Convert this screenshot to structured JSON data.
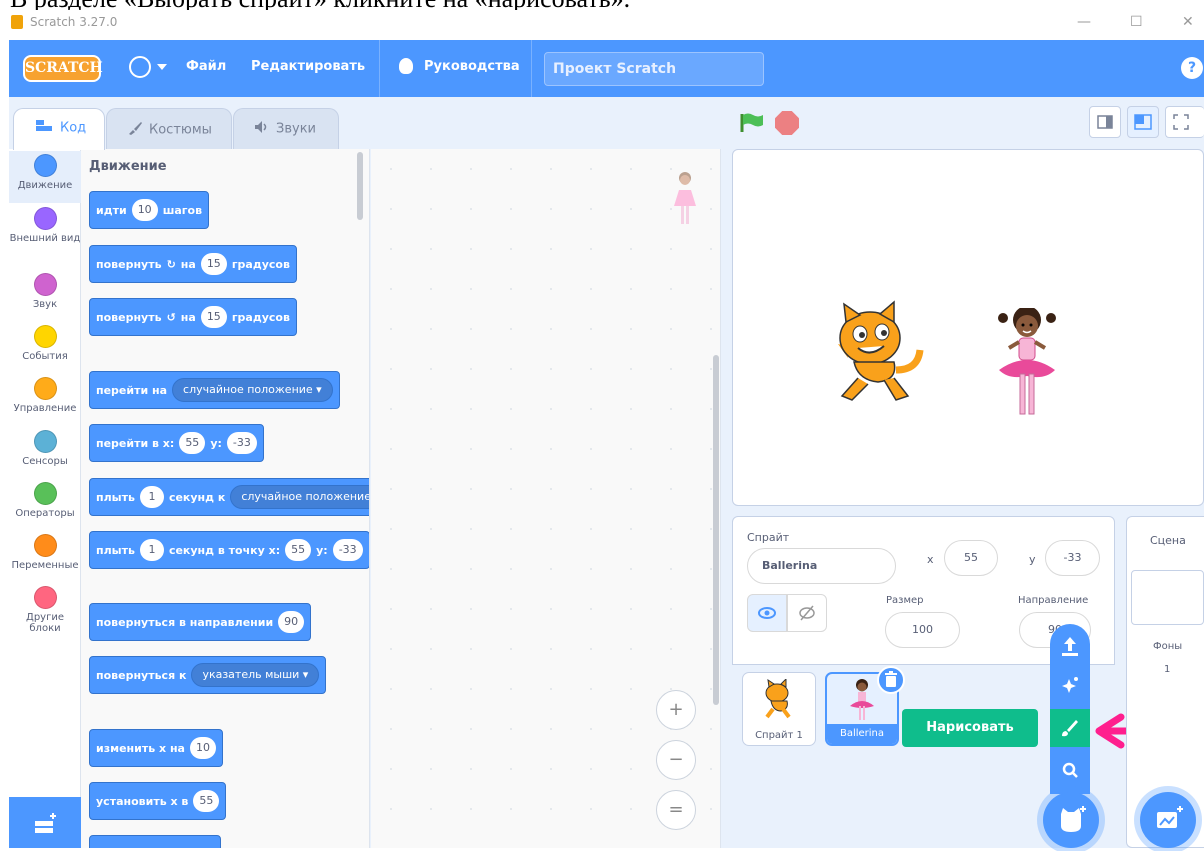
{
  "caption": "В разделе «Выбрать спрайт» кликните на «нарисовать».",
  "window": {
    "title": "Scratch 3.27.0",
    "minimize": "—",
    "maximize": "☐",
    "close": "✕"
  },
  "menubar": {
    "logo": "SCRATCH",
    "file": "Файл",
    "edit": "Редактировать",
    "tutorials": "Руководства",
    "project_title": "Проект Scratch",
    "help": "?"
  },
  "tabs": {
    "code": "Код",
    "costumes": "Костюмы",
    "sounds": "Звуки"
  },
  "categories": [
    {
      "label": "Движение",
      "color": "#4c97ff"
    },
    {
      "label": "Внешний вид",
      "color": "#9966ff"
    },
    {
      "label": "Звук",
      "color": "#cf63cf"
    },
    {
      "label": "События",
      "color": "#ffd500"
    },
    {
      "label": "Управление",
      "color": "#ffab19"
    },
    {
      "label": "Сенсоры",
      "color": "#5cb1d6"
    },
    {
      "label": "Операторы",
      "color": "#59c059"
    },
    {
      "label": "Переменные",
      "color": "#ff8c1a"
    },
    {
      "label": "Другие блоки",
      "color": "#ff6680"
    }
  ],
  "palette": {
    "title": "Движение",
    "move": {
      "pre": "идти",
      "val": "10",
      "post": "шагов"
    },
    "turn_right": {
      "pre": "повернуть",
      "on": "на",
      "val": "15",
      "post": "градусов"
    },
    "turn_left": {
      "pre": "повернуть",
      "on": "на",
      "val": "15",
      "post": "градусов"
    },
    "goto": {
      "pre": "перейти на",
      "dd": "случайное положение ▾"
    },
    "goto_xy": {
      "pre": "перейти в x:",
      "x": "55",
      "ylbl": "y:",
      "y": "-33"
    },
    "glide": {
      "pre": "плыть",
      "val": "1",
      "mid": "секунд к",
      "dd": "случайное положение"
    },
    "glide_xy": {
      "pre": "плыть",
      "val": "1",
      "mid": "секунд в точку x:",
      "x": "55",
      "ylbl": "y:",
      "y": "-33"
    },
    "point_dir": {
      "pre": "повернуться в направлении",
      "val": "90"
    },
    "point_to": {
      "pre": "повернуться к",
      "dd": "указатель мыши ▾"
    },
    "change_x": {
      "pre": "изменить х на",
      "val": "10"
    },
    "set_x": {
      "pre": "установить х в",
      "val": "55"
    }
  },
  "zoom": {
    "in": "+",
    "out": "−",
    "reset": "="
  },
  "sprite_info": {
    "sprite_label": "Спрайт",
    "name": "Ballerina",
    "x_label": "x",
    "x": "55",
    "y_label": "y",
    "y": "-33",
    "size_label": "Размер",
    "size": "100",
    "direction_label": "Направление",
    "direction": "90"
  },
  "sprites": [
    {
      "name": "Спрайт 1"
    },
    {
      "name": "Ballerina"
    }
  ],
  "sprite_menu": {
    "tooltip": "Нарисовать"
  },
  "stage_pane": {
    "label": "Сцена",
    "backdrops_label": "Фоны",
    "backdrops_count": "1"
  },
  "colors": {
    "accent": "#4c97ff",
    "paint": "#0fbd8c",
    "arrow": "#ff1f8e"
  }
}
